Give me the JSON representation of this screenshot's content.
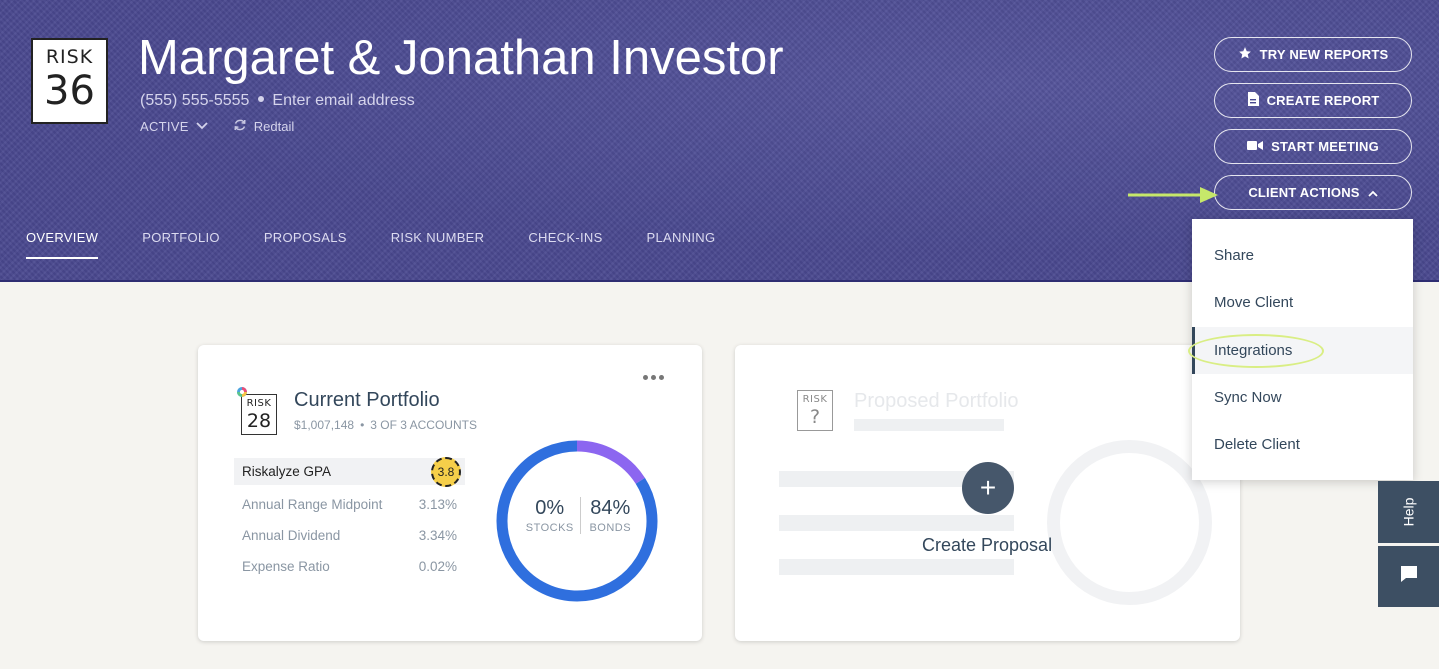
{
  "header": {
    "risk_badge": {
      "label": "RISK",
      "number": "36"
    },
    "client_name": "Margaret & Jonathan Investor",
    "phone": "(555) 555-5555",
    "email_placeholder": "Enter email address",
    "status": "ACTIVE",
    "crm": "Redtail",
    "buttons": {
      "try_new_reports": "TRY NEW REPORTS",
      "create_report": "CREATE REPORT",
      "start_meeting": "START MEETING",
      "client_actions": "CLIENT ACTIONS"
    },
    "tabs": [
      "OVERVIEW",
      "PORTFOLIO",
      "PROPOSALS",
      "RISK NUMBER",
      "CHECK-INS",
      "PLANNING"
    ],
    "active_tab": "OVERVIEW",
    "colors": {
      "background": "#4a4990",
      "arrow": "#c6e86a"
    }
  },
  "client_actions_menu": {
    "items": [
      "Share",
      "Move Client",
      "Integrations",
      "Sync Now",
      "Delete Client"
    ],
    "highlighted": "Integrations"
  },
  "current_portfolio": {
    "risk_badge": {
      "label": "RISK",
      "number": "28"
    },
    "title": "Current Portfolio",
    "value": "$1,007,148",
    "accounts": "3 OF 3 ACCOUNTS",
    "metrics": [
      {
        "label": "Riskalyze GPA",
        "value": "3.8"
      },
      {
        "label": "Annual Range Midpoint",
        "value": "3.13%"
      },
      {
        "label": "Annual Dividend",
        "value": "3.34%"
      },
      {
        "label": "Expense Ratio",
        "value": "0.02%"
      }
    ],
    "allocation": {
      "stocks_pct": "0%",
      "stocks_label": "STOCKS",
      "bonds_pct": "84%",
      "bonds_label": "BONDS",
      "segments": [
        {
          "fraction": 0.84,
          "color": "#2f6fde"
        },
        {
          "fraction": 0.16,
          "color": "#8c66f0"
        }
      ]
    }
  },
  "proposed_portfolio": {
    "risk_badge": {
      "label": "RISK",
      "number": "?"
    },
    "title": "Proposed Portfolio",
    "action_label": "Create Proposal"
  },
  "side_tabs": {
    "help": "Help"
  }
}
